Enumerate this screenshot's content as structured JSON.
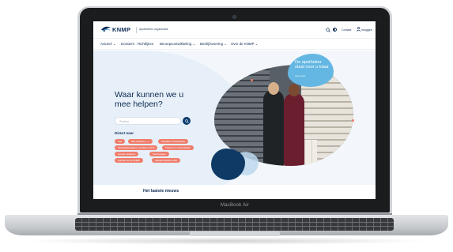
{
  "device": {
    "brand_label": "MacBook Air"
  },
  "header": {
    "logo_text": "KNMP",
    "tagline": "Apothekers organisatie",
    "contact_label": "Contact",
    "login_label": "Inloggen"
  },
  "nav": {
    "items": [
      {
        "label": "Actueel ⌄"
      },
      {
        "label": "Dossiers"
      },
      {
        "label": "Richtlijnen"
      },
      {
        "label": "Beroepsontwikkeling ⌄"
      },
      {
        "label": "Bedrijfsvoering ⌄"
      },
      {
        "label": "Over de KNMP ⌄"
      }
    ]
  },
  "hero": {
    "title": "Waar kunnen we u mee helpen?",
    "search_placeholder": "Zoeken",
    "direct_label": "Direct naar",
    "chips": [
      {
        "label": "Cao"
      },
      {
        "label": "Wat verdient u ...?"
      },
      {
        "label": "Tarieflijst in behandeling"
      },
      {
        "label": "Medicatiebewaking, modulaire inzicht"
      },
      {
        "label": "Tarieven en vergoedingen"
      },
      {
        "label": "Actuele vacatures"
      },
      {
        "label": "Nascholingen"
      },
      {
        "label": "Agenda van de KNMP"
      },
      {
        "label": "Jaargemiddelde toolkit"
      }
    ],
    "callout_text": "De apotheker staat voor u klaar",
    "callout_link": "Lees meer"
  },
  "news": {
    "title": "Het laatste nieuws"
  },
  "colors": {
    "navy": "#0d2b53",
    "accent_coral": "#ef7d6c",
    "callout_blue": "#64b7e2",
    "dark_blob": "#0f3a66"
  }
}
